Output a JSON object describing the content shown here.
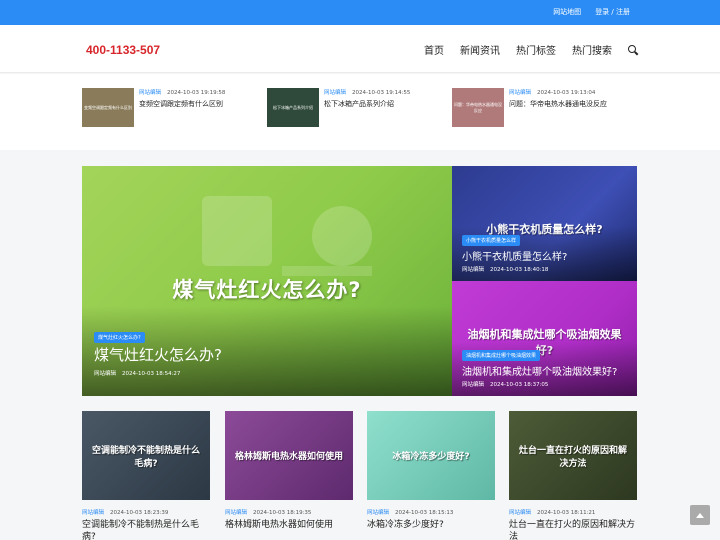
{
  "topbar": {
    "sitemap": "网站地图",
    "login": "登录 / 注册"
  },
  "header": {
    "phone": "400-1133-507",
    "nav": [
      "首页",
      "新闻资讯",
      "热门标签",
      "热门搜索"
    ]
  },
  "hot": [
    {
      "thumb": "变频空调跟定频有什么区别",
      "author": "网站编辑",
      "date": "2024-10-03 19:19:58",
      "title": "变频空调跟定频有什么区别",
      "color": "#8a7c5a"
    },
    {
      "thumb": "松下冰箱产品系列介绍",
      "author": "网站编辑",
      "date": "2024-10-03 19:14:55",
      "title": "松下冰箱产品系列介绍",
      "color": "#2f4a3a"
    },
    {
      "thumb": "问题：华帝电热水器通电没反应",
      "author": "网站编辑",
      "date": "2024-10-03 19:13:04",
      "title": "问题：华帝电热水器通电没反应",
      "color": "#b07a7a"
    }
  ],
  "feature": {
    "big": {
      "overlay": "煤气灶红火怎么办?",
      "tag": "煤气灶红火怎么办?",
      "title": "煤气灶红火怎么办?",
      "author": "网站编辑",
      "date": "2024-10-03 18:54:27"
    },
    "s1": {
      "overlay": "小熊干衣机质量怎么样?",
      "tag": "小熊干衣机质量怎么样",
      "title": "小熊干衣机质量怎么样?",
      "author": "网站编辑",
      "date": "2024-10-03 18:40:18"
    },
    "s2": {
      "overlay": "油烟机和集成灶哪个吸油烟效果好?",
      "tag": "油烟机和集成灶哪个吸油烟效果",
      "title": "油烟机和集成灶哪个吸油烟效果好?",
      "author": "网站编辑",
      "date": "2024-10-03 18:37:05"
    }
  },
  "cards": [
    {
      "img": "空调能制冷不能制热是什么毛病?",
      "author": "网站编辑",
      "date": "2024-10-03 18:23:39",
      "title": "空调能制冷不能制热是什么毛病?",
      "color": "#3c4a55"
    },
    {
      "img": "格林姆斯电热水器如何使用",
      "author": "网站编辑",
      "date": "2024-10-03 18:19:35",
      "title": "格林姆斯电热水器如何使用",
      "color": "#7a3a86"
    },
    {
      "img": "冰箱冷冻多少度好?",
      "author": "网站编辑",
      "date": "2024-10-03 18:15:13",
      "title": "冰箱冷冻多少度好?",
      "color": "#7fd1c0"
    },
    {
      "img": "灶台一直在打火的原因和解决方法",
      "author": "网站编辑",
      "date": "2024-10-03 18:11:21",
      "title": "灶台一直在打火的原因和解决方法",
      "color": "#3d4a2c"
    }
  ]
}
